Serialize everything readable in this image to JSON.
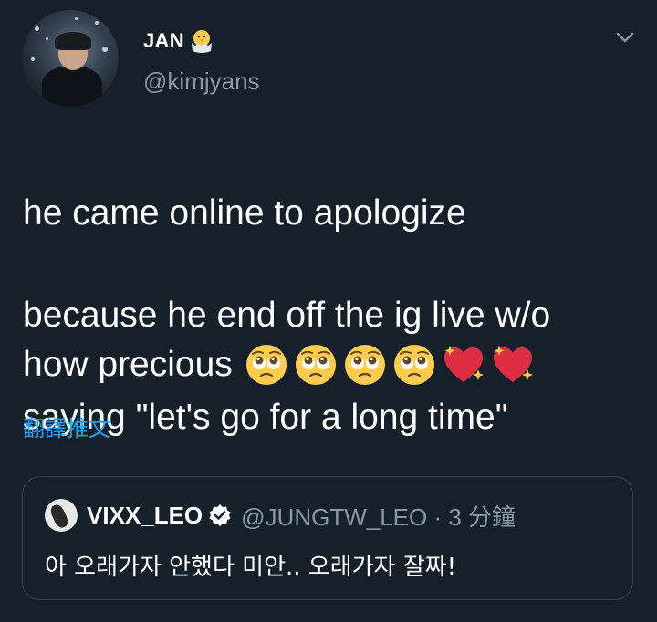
{
  "author": {
    "display_name": "JAN",
    "name_emoji": "hatching-chick",
    "handle": "@kimjyans",
    "avatar": "user-avatar"
  },
  "menu_icon": "chevron-down-icon",
  "tweet": {
    "lines": [
      "he came online to apologize",
      "because he end off the ig live w/o",
      "saying \"let's go for a long time\""
    ],
    "closing": "how precious",
    "emojis": [
      "pleading-face",
      "pleading-face",
      "pleading-face",
      "pleading-face",
      "sparkling-heart",
      "sparkling-heart"
    ]
  },
  "translate_label": "翻譯推文",
  "quoted": {
    "display_name": "VIXX_LEO",
    "verified": true,
    "handle_time": "@JUNGTW_LEO · 3 分鐘",
    "text": "아 오래가자 안했다 미안.. 오래가자 잘짜!"
  },
  "colors": {
    "background": "#15202b",
    "text": "#ffffff",
    "secondary": "#8899a6",
    "link": "#1da1f2",
    "border": "#38444d"
  }
}
